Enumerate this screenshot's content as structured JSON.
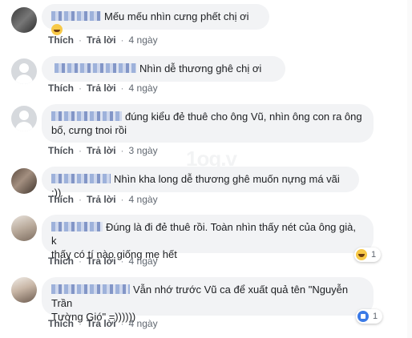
{
  "comments": [
    {
      "text": "Mếu mếu nhìn cưng phết chị ơi",
      "time": "4 ngày",
      "emoji": "haha"
    },
    {
      "text": "Nhìn dễ thương ghê chị ơi",
      "time": "4 ngày"
    },
    {
      "line1": "đúng kiểu đẻ thuê cho ông Vũ, nhìn ông con ra ông",
      "line2": "bố, cưng tnoi rồi",
      "time": "3 ngày"
    },
    {
      "text": "Nhìn kha long dễ thương ghê muốn nựng má vãi :))",
      "time": "4 ngày"
    },
    {
      "line1": "Đúng là đi đẻ thuê rồi. Toàn nhìn thấy nét của ông già, k",
      "line2": "thấy có tí nào giống mẹ hết",
      "time": "4 ngày",
      "reaction": {
        "type": "haha",
        "count": "1"
      }
    },
    {
      "line1": "Vẫn nhớ trước Vũ ca để xuất quả tên \"Nguyễn Trần",
      "line2": "Tường Gió\" =))))))",
      "time": "4 ngày",
      "reaction": {
        "type": "like",
        "count": "1"
      }
    }
  ],
  "actions": {
    "like": "Thích",
    "reply": "Trả lời",
    "separator": "·"
  },
  "watermark": "1og.v"
}
